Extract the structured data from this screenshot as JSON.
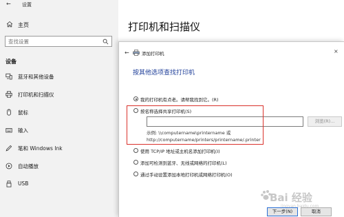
{
  "window": {
    "back_glyph": "←",
    "title": "设置"
  },
  "sidebar": {
    "home_label": "主页",
    "search_placeholder": "查找设置",
    "section_title": "设备",
    "items": [
      {
        "label": "蓝牙和其他设备",
        "icon": "bluetooth-devices-icon"
      },
      {
        "label": "打印机和扫描仪",
        "icon": "printer-icon",
        "active": true
      },
      {
        "label": "鼠标",
        "icon": "mouse-icon"
      },
      {
        "label": "输入",
        "icon": "keyboard-icon"
      },
      {
        "label": "笔和 Windows Ink",
        "icon": "pen-icon"
      },
      {
        "label": "自动播放",
        "icon": "autoplay-icon"
      },
      {
        "label": "USB",
        "icon": "usb-icon"
      }
    ]
  },
  "main": {
    "title": "打印机和扫描仪"
  },
  "dialog": {
    "back_glyph": "←",
    "close_glyph": "×",
    "title": "添加打印机",
    "heading": "按其他选项查找打印机",
    "options": [
      {
        "label": "我的打印机有点老。请帮我找到它。(R)",
        "checked": true
      },
      {
        "label": "按名称选择共享打印机(S)",
        "checked": false
      },
      {
        "label": "使用 TCP/IP 地址或主机名添加打印机(I)",
        "checked": false
      },
      {
        "label": "添加可检测到蓝牙、无线或网络的打印机(L)",
        "checked": false
      },
      {
        "label": "通过手动设置添加本地打印机或网络打印机(O)",
        "checked": false
      }
    ],
    "shared_printer_value": "",
    "browse_label": "浏览(R)...",
    "example_line1": "示例: \\\\computername\\printername 或",
    "example_line2": "http://computername/printers/printername/.printer",
    "next_label": "下一步(N)",
    "cancel_label": "取消"
  },
  "watermark": {
    "main": "Bai 经验",
    "sub": "jingyan.baidu.com"
  },
  "colors": {
    "sidebar_bg": "#f2f2f2",
    "heading_blue": "#1f3f99",
    "highlight_red": "#d9302a",
    "focus_blue": "#2a6fd6"
  }
}
